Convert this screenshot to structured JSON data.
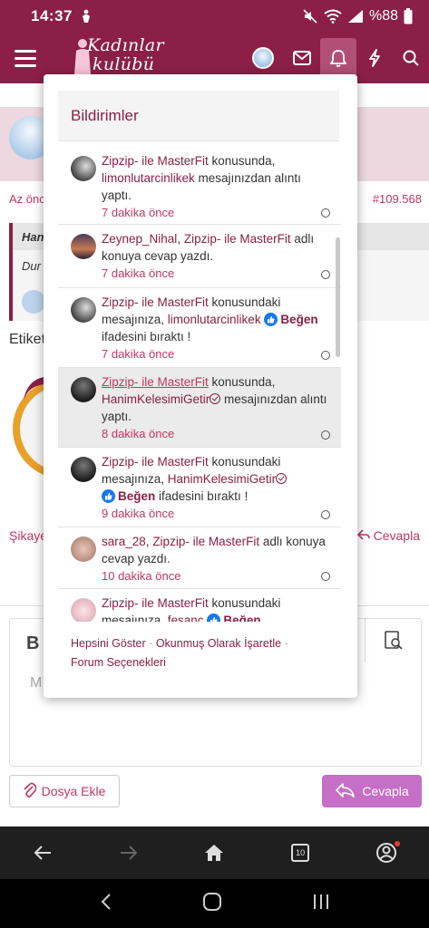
{
  "status_bar": {
    "time": "14:37",
    "battery": "%88"
  },
  "header": {
    "logo_line1": "Kadınlar",
    "logo_line2": "kulübü",
    "icons": [
      "menu-icon",
      "avatar",
      "mail-icon",
      "bell-icon",
      "bolt-icon",
      "search-icon"
    ]
  },
  "background_page": {
    "post_time": "Az önce",
    "post_number": "#109.568",
    "quote_author": "Han",
    "quote_text": "Dur",
    "tags_label": "Etiket",
    "report_link": "Şikayet",
    "reply_link": "Cevapla",
    "editor_bold": "B",
    "editor_placeholder": "M",
    "attach_button": "Dosya Ekle",
    "reply_button": "Cevapla"
  },
  "notifications": {
    "title": "Bildirimler",
    "items": [
      {
        "user": "Zipzip- ile MasterFit",
        "text1": " konusunda,",
        "user2": "limonlutarcinlikek",
        "text2": " mesajınızdan alıntı yaptı.",
        "time": "7 dakika önce"
      },
      {
        "user": "Zeynep_Nihal",
        "sep": ", ",
        "user2": "Zipzip- ile MasterFit",
        "text2": " adlı konuya cevap yazdı.",
        "time": "7 dakika önce"
      },
      {
        "user": "Zipzip- ile MasterFit",
        "text1": " konusundaki mesajınıza, ",
        "user2": "limonlutarcinlikek",
        "reaction": "Beğen",
        "text2": " ifadesini bıraktı !",
        "time": "7 dakika önce"
      },
      {
        "user": "Zipzip- ile MasterFit",
        "text1": " konusunda, ",
        "user2": "HanimKelesimiGetir",
        "text2": " mesajınızdan alıntı yaptı.",
        "time": "8 dakika önce"
      },
      {
        "user": "Zipzip- ile MasterFit",
        "text1": " konusundaki mesajınıza, ",
        "user2": "HanimKelesimiGetir",
        "reaction": "Beğen",
        "text2": " ifadesini bıraktı !",
        "time": "9 dakika önce"
      },
      {
        "user": "sara_28",
        "sep": ", ",
        "user2": "Zipzip- ile MasterFit",
        "text2": " adlı konuya cevap yazdı.",
        "time": "10 dakika önce"
      },
      {
        "user": "Zipzip- ile MasterFit",
        "text1": " konusundaki mesajınıza, ",
        "user2": "fesanç",
        "reaction": "Beğen"
      }
    ],
    "footer": {
      "show_all": "Hepsini Göster",
      "mark_read": "Okunmuş Olarak İşaretle",
      "forum_options": "Forum Seçenekleri",
      "separator": "·"
    }
  },
  "browser_toolbar": {
    "tab_count": "10"
  },
  "colors": {
    "brand": "#8b1f47",
    "link": "#c0385f",
    "reply_button": "#c56fc6"
  }
}
